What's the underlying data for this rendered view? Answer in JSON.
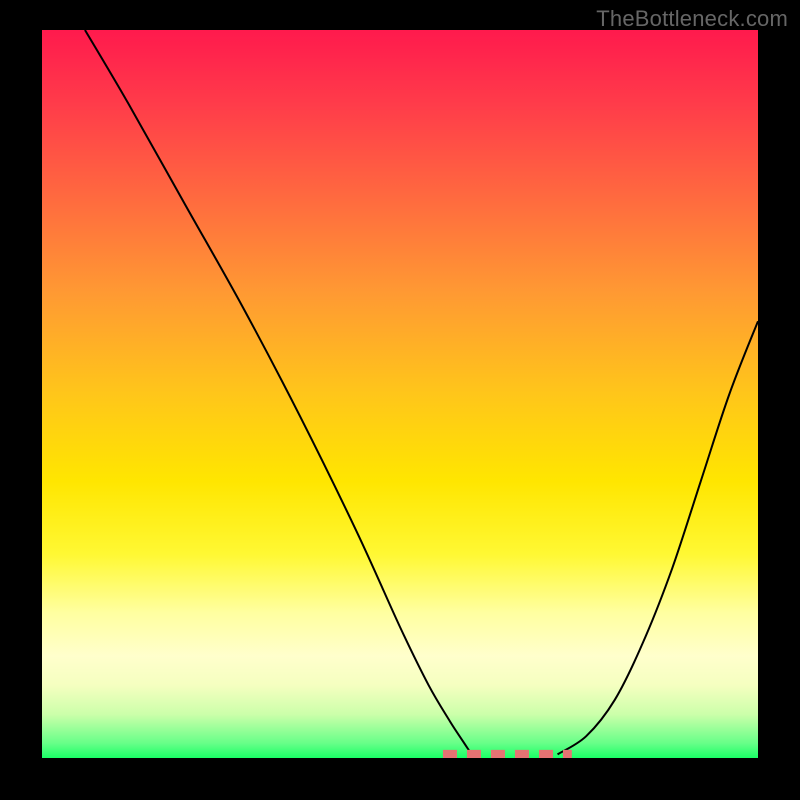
{
  "watermark": "TheBottleneck.com",
  "chart_data": {
    "type": "line",
    "title": "",
    "xlabel": "",
    "ylabel": "",
    "xlim": [
      0,
      100
    ],
    "ylim": [
      0,
      100
    ],
    "grid": false,
    "series": [
      {
        "name": "left-branch",
        "x": [
          6,
          12,
          20,
          28,
          36,
          44,
          50,
          54,
          57,
          59,
          60
        ],
        "y": [
          100,
          90,
          76,
          62,
          47,
          31,
          18,
          10,
          5,
          2,
          0.5
        ]
      },
      {
        "name": "right-branch",
        "x": [
          72,
          76,
          80,
          84,
          88,
          92,
          96,
          100
        ],
        "y": [
          0.5,
          3,
          8,
          16,
          26,
          38,
          50,
          60
        ]
      }
    ],
    "annotations": [
      {
        "name": "optimal-band",
        "type": "dashed-segment",
        "x_range": [
          56,
          74
        ],
        "y": 0.5
      }
    ],
    "colors": {
      "top": "#ff1a4d",
      "mid": "#ffe600",
      "bottom": "#1aff66",
      "marker": "#e57373"
    }
  }
}
